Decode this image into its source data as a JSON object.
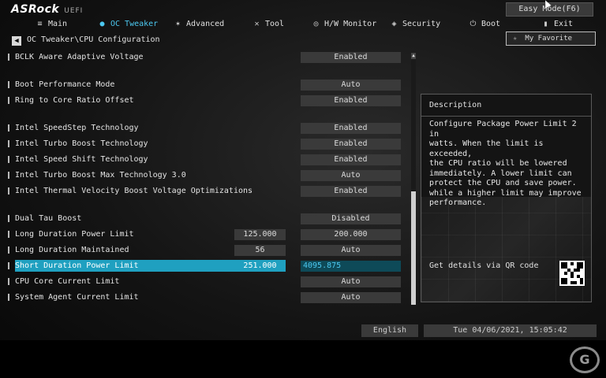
{
  "brand": {
    "name": "ASRock",
    "sub": "UEFI"
  },
  "easy_mode": "Easy Mode(F6)",
  "nav": [
    {
      "label": "Main",
      "icon": "list-icon",
      "glyph": "≡"
    },
    {
      "label": "OC Tweaker",
      "icon": "flame-icon",
      "glyph": "●"
    },
    {
      "label": "Advanced",
      "icon": "star-icon",
      "glyph": "✶"
    },
    {
      "label": "Tool",
      "icon": "tools-icon",
      "glyph": "✕"
    },
    {
      "label": "H/W Monitor",
      "icon": "monitor-icon",
      "glyph": "◎"
    },
    {
      "label": "Security",
      "icon": "shield-icon",
      "glyph": "◈"
    },
    {
      "label": "Boot",
      "icon": "power-icon",
      "glyph": "⏻"
    },
    {
      "label": "Exit",
      "icon": "exit-icon",
      "glyph": "▮"
    }
  ],
  "breadcrumb": "OC Tweaker\\CPU Configuration",
  "favorite": "My Favorite",
  "settings": [
    {
      "label": "BCLK Aware Adaptive Voltage",
      "value": "Enabled"
    },
    {
      "label": "Boot Performance Mode",
      "value": "Auto"
    },
    {
      "label": "Ring to Core Ratio Offset",
      "value": "Enabled"
    },
    {
      "label": "Intel SpeedStep Technology",
      "value": "Enabled"
    },
    {
      "label": "Intel Turbo Boost Technology",
      "value": "Enabled"
    },
    {
      "label": "Intel Speed Shift Technology",
      "value": "Enabled"
    },
    {
      "label": "Intel Turbo Boost Max Technology 3.0",
      "value": "Auto"
    },
    {
      "label": "Intel Thermal Velocity Boost Voltage Optimizations",
      "value": "Enabled"
    },
    {
      "label": "Dual Tau Boost",
      "value": "Disabled"
    },
    {
      "label": "Long Duration Power Limit",
      "current": "125.000",
      "value": "200.000"
    },
    {
      "label": "Long Duration Maintained",
      "current": "56",
      "value": "Auto"
    },
    {
      "label": "Short Duration Power Limit",
      "current": "251.000",
      "value": "4095.875"
    },
    {
      "label": "CPU Core Current Limit",
      "value": "Auto"
    },
    {
      "label": "System Agent Current Limit",
      "value": "Auto"
    }
  ],
  "description": {
    "title": "Description",
    "text": "Configure Package Power Limit 2 in\nwatts. When the limit is exceeded,\nthe CPU ratio will be lowered\nimmediately. A lower limit can\nprotect the CPU and save power.\nwhile a higher limit may improve\nperformance.",
    "qr_label": "Get details via QR code"
  },
  "footer": {
    "language": "English",
    "datetime": "Tue 04/06/2021, 15:05:42"
  },
  "colors": {
    "accent": "#4cc8f0",
    "highlight": "#1fa0c0"
  }
}
